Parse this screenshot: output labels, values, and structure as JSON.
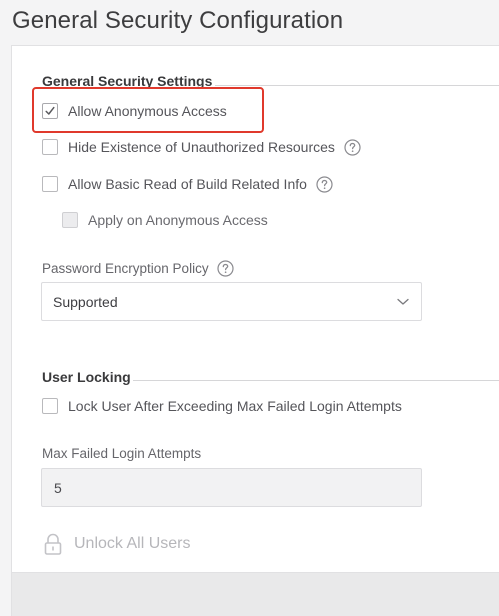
{
  "page": {
    "title": "General Security Configuration"
  },
  "general_settings": {
    "heading": "General Security Settings",
    "allow_anonymous_access": {
      "label": "Allow Anonymous Access",
      "checked": true
    },
    "hide_unauthorized": {
      "label": "Hide Existence of Unauthorized Resources",
      "checked": false,
      "help_icon": "question-circle-icon"
    },
    "allow_basic_read": {
      "label": "Allow Basic Read of Build Related Info",
      "checked": false,
      "help_icon": "question-circle-icon"
    },
    "apply_on_anonymous": {
      "label": "Apply on Anonymous Access",
      "checked": false,
      "disabled": true
    },
    "password_policy": {
      "label": "Password Encryption Policy",
      "help_icon": "question-circle-icon",
      "value": "Supported",
      "dropdown_icon": "chevron-down-icon"
    }
  },
  "user_locking": {
    "heading": "User Locking",
    "lock_user": {
      "label": "Lock User After Exceeding Max Failed Login Attempts",
      "checked": false
    },
    "max_failed": {
      "label": "Max Failed Login Attempts",
      "value": "5"
    },
    "unlock_all": {
      "label": "Unlock All Users",
      "icon": "lock-icon",
      "disabled": true
    }
  },
  "colors": {
    "highlight": "#e0392c",
    "text": "#55555a",
    "disabled_text": "#b6b6ba"
  }
}
